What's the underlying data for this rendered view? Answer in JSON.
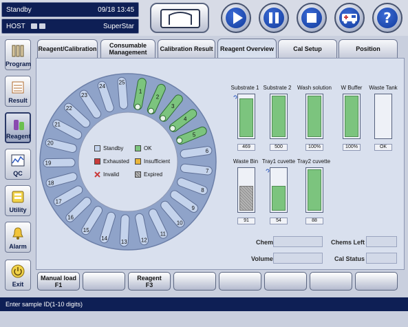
{
  "status": {
    "state": "Standby",
    "datetime": "09/18 13:45",
    "host": "HOST",
    "system": "SuperStar"
  },
  "toolbar": {
    "home": "home-icon",
    "play": "play-icon",
    "pause": "pause-icon",
    "stop": "stop-icon",
    "ambulance": "ambulance-icon",
    "help": "help-icon"
  },
  "nav": {
    "program": "Program",
    "result": "Result",
    "reagent": "Reagent",
    "qc": "QC",
    "utility": "Utility",
    "alarm": "Alarm",
    "exit": "Exit"
  },
  "tabs": [
    "Reagent/Calibration",
    "Consumable Management",
    "Calibration Result",
    "Reagent Overview",
    "Cal Setup",
    "Position"
  ],
  "active_tab": "Reagent Overview",
  "wheel": {
    "positions": [
      "1",
      "2",
      "3",
      "4",
      "5",
      "6",
      "7",
      "8",
      "9",
      "10",
      "11",
      "12",
      "13",
      "14",
      "15",
      "16",
      "17",
      "18",
      "19",
      "20",
      "21",
      "22",
      "23",
      "24",
      "25"
    ],
    "ok_positions": [
      "1",
      "2",
      "3",
      "4",
      "5"
    ],
    "colors": {
      "standby": "#c4d3ec",
      "ok": "#7cc47e",
      "ring": "#8fa3c9"
    }
  },
  "legend": {
    "standby": "Standby",
    "ok": "OK",
    "exhausted": "Exhausted",
    "insufficient": "Insufficient",
    "invalid": "Invalid",
    "expired": "Expired",
    "colors": {
      "standby": "#c4d3ec",
      "ok": "#7cc47e",
      "exhausted": "#c93b3b",
      "insufficient": "#e9b53a"
    }
  },
  "bottles": {
    "substrate1": {
      "label": "Substrate 1",
      "value": "469",
      "level": 0.94
    },
    "substrate2": {
      "label": "Substrate 2",
      "value": "500",
      "level": 1.0
    },
    "wash": {
      "label": "Wash solution",
      "value": "100%",
      "level": 1.0
    },
    "wbuffer": {
      "label": "W Buffer",
      "value": "100%",
      "level": 1.0
    },
    "wastetank": {
      "label": "Waste Tank",
      "value": "OK",
      "level": 0
    },
    "wastebin": {
      "label": "Waste Bin",
      "value": "91",
      "level": 0.6
    },
    "tray1": {
      "label": "Tray1 cuvette",
      "value": "54",
      "level": 0.6
    },
    "tray2": {
      "label": "Tray2 cuvette",
      "value": "88",
      "level": 1.0
    }
  },
  "info": {
    "chem": "Chem",
    "chems_left": "Chems Left",
    "volume": "Volume",
    "cal_status": "Cal Status"
  },
  "fkeys": {
    "f1_line1": "Manual load",
    "f1_line2": "F1",
    "f3_line1": "Reagent",
    "f3_line2": "F3"
  },
  "message": "Enter sample ID(1-10 digits)"
}
